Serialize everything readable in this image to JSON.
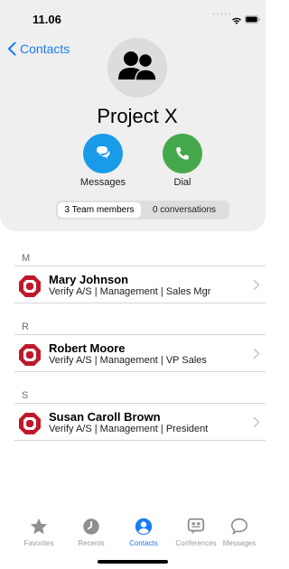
{
  "status_bar": {
    "time": "11.06"
  },
  "nav": {
    "back_label": "Contacts"
  },
  "group": {
    "title": "Project X"
  },
  "actions": [
    {
      "label": "Messages",
      "icon": "chat-bubbles-icon",
      "color": "#1a9bea"
    },
    {
      "label": "Dial",
      "icon": "phone-icon",
      "color": "#45a84a"
    }
  ],
  "segments": {
    "members": "3 Team members",
    "conversations": "0 conversations"
  },
  "sections": [
    {
      "letter": "M",
      "contacts": [
        {
          "name": "Mary Johnson",
          "subtitle": "Verify A/S | Management | Sales Mgr"
        }
      ]
    },
    {
      "letter": "R",
      "contacts": [
        {
          "name": "Robert Moore",
          "subtitle": "Verify A/S | Management | VP Sales"
        }
      ]
    },
    {
      "letter": "S",
      "contacts": [
        {
          "name": "Susan Caroll Brown",
          "subtitle": "Verify A/S | Management | President"
        }
      ]
    }
  ],
  "tabs": [
    {
      "label": "Favorites",
      "icon": "star-icon"
    },
    {
      "label": "Recents",
      "icon": "clock-icon"
    },
    {
      "label": "Contacts",
      "icon": "person-circle-icon",
      "active": true
    },
    {
      "label": "Conferences",
      "icon": "conference-icon"
    },
    {
      "label": "Messages",
      "icon": "speech-bubble-icon"
    }
  ],
  "colors": {
    "accent": "#1a7cf5",
    "logo_red": "#c0182b",
    "header_bg": "#efefef"
  }
}
